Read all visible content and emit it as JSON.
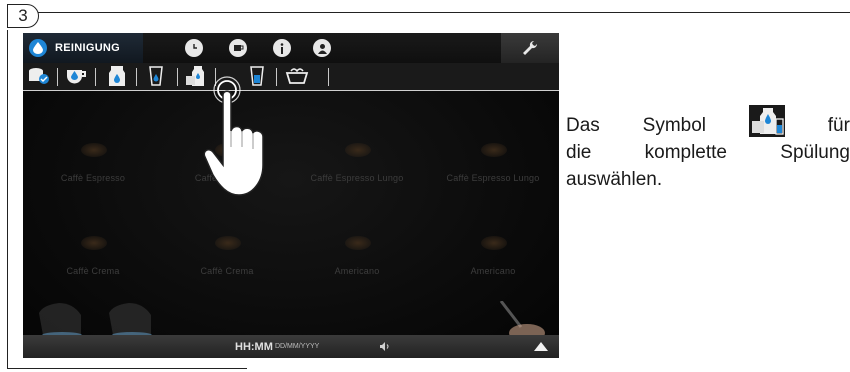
{
  "step": {
    "number": "3"
  },
  "screen": {
    "tab": {
      "label": "REINIGUNG",
      "icon": "water-drop-icon"
    },
    "nav_icons": [
      "clock-icon",
      "cup-icon",
      "info-icon",
      "user-icon"
    ],
    "settings_icon": "wrench-icon",
    "tools": [
      "descale-icon",
      "cup-rinse-icon",
      "milk-clean-icon",
      "glass-rinse-icon",
      "complete-rinse-icon",
      "glass-water-icon",
      "dish-icon"
    ],
    "drinks": [
      {
        "label": "Caffè Espresso"
      },
      {
        "label": "Caffè Espresso"
      },
      {
        "label": "Caffè Espresso Lungo"
      },
      {
        "label": "Caffè Espresso Lungo"
      },
      {
        "label": "Caffè Crema"
      },
      {
        "label": "Caffè Crema"
      },
      {
        "label": "Americano"
      },
      {
        "label": "Americano"
      }
    ],
    "status": {
      "time": "HH:MM",
      "date": "DD/MM/YYYY"
    }
  },
  "instruction": {
    "w1": "Das",
    "w2": "Symbol",
    "w3": "für",
    "l2a": "die",
    "l2b": "komplette",
    "l2c": "Spülung",
    "l3": "auswählen."
  },
  "colors": {
    "accent": "#1e86d6",
    "screen_bg": "#0b0b0b"
  }
}
